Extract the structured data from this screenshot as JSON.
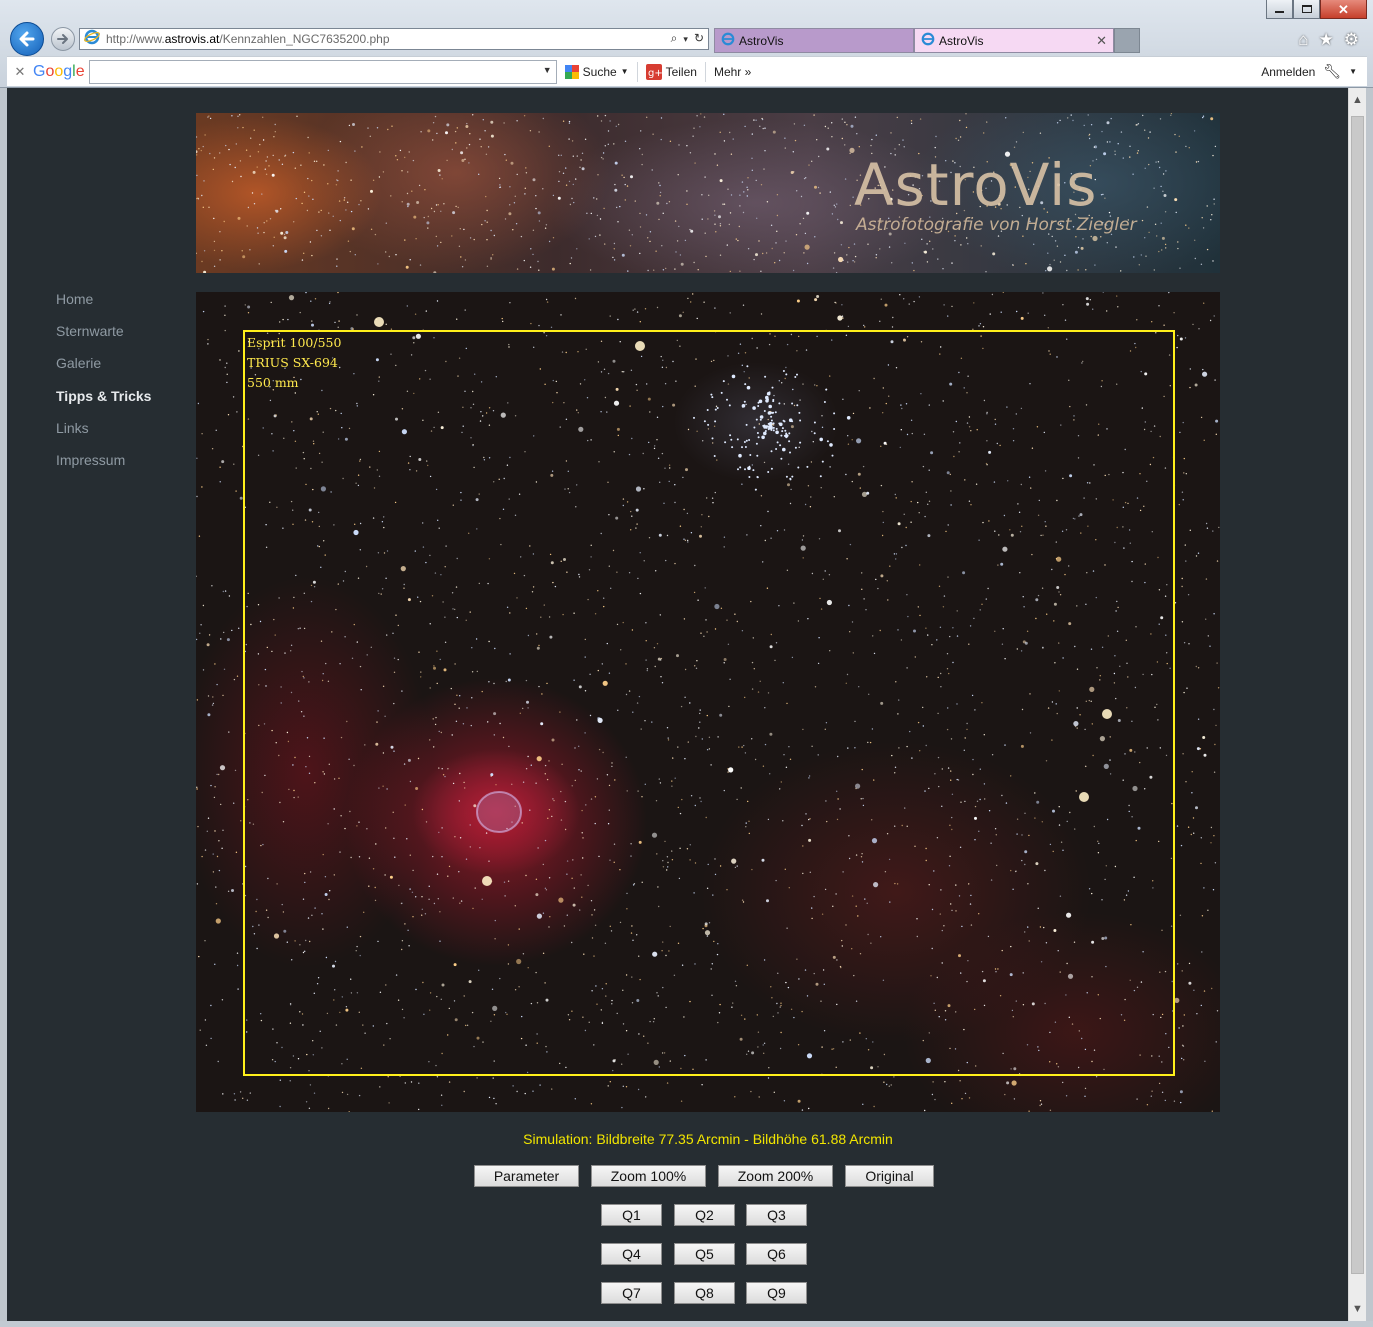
{
  "browser": {
    "url_prefix": "http://www.",
    "url_domain": "astrovis.at",
    "url_path": "/Kennzahlen_NGC7635200.php",
    "tabs": [
      {
        "label": "AstroVis"
      },
      {
        "label": "AstroVis"
      }
    ],
    "toolbar": {
      "google_logo": "Google",
      "search_label": "Suche",
      "share_label": "Teilen",
      "more_label": "Mehr »",
      "signin_label": "Anmelden"
    }
  },
  "banner": {
    "title": "AstroVis",
    "subtitle": "Astrofotografie von Horst Ziegler"
  },
  "nav": {
    "items": [
      {
        "label": "Home",
        "active": false
      },
      {
        "label": "Sternwarte",
        "active": false
      },
      {
        "label": "Galerie",
        "active": false
      },
      {
        "label": "Tipps & Tricks",
        "active": true
      },
      {
        "label": "Links",
        "active": false
      },
      {
        "label": "Impressum",
        "active": false
      }
    ]
  },
  "image": {
    "labels": [
      "Esprit 100/550",
      "TRIUS SX-694",
      "550 mm"
    ],
    "frame_color": "#ffef1a"
  },
  "simulation": {
    "text": "Simulation: Bildbreite 77.35 Arcmin - Bildhöhe 61.88 Arcmin"
  },
  "buttons": {
    "row1": [
      "Parameter",
      "Zoom 100%",
      "Zoom 200%",
      "Original"
    ],
    "grid": [
      "Q1",
      "Q2",
      "Q3",
      "Q4",
      "Q5",
      "Q6",
      "Q7",
      "Q8",
      "Q9"
    ]
  },
  "colors": {
    "page_bg": "#262d32",
    "nav_text": "#8f9aa3",
    "nav_active": "#e6e9ec",
    "sim_text": "#f2e600"
  }
}
